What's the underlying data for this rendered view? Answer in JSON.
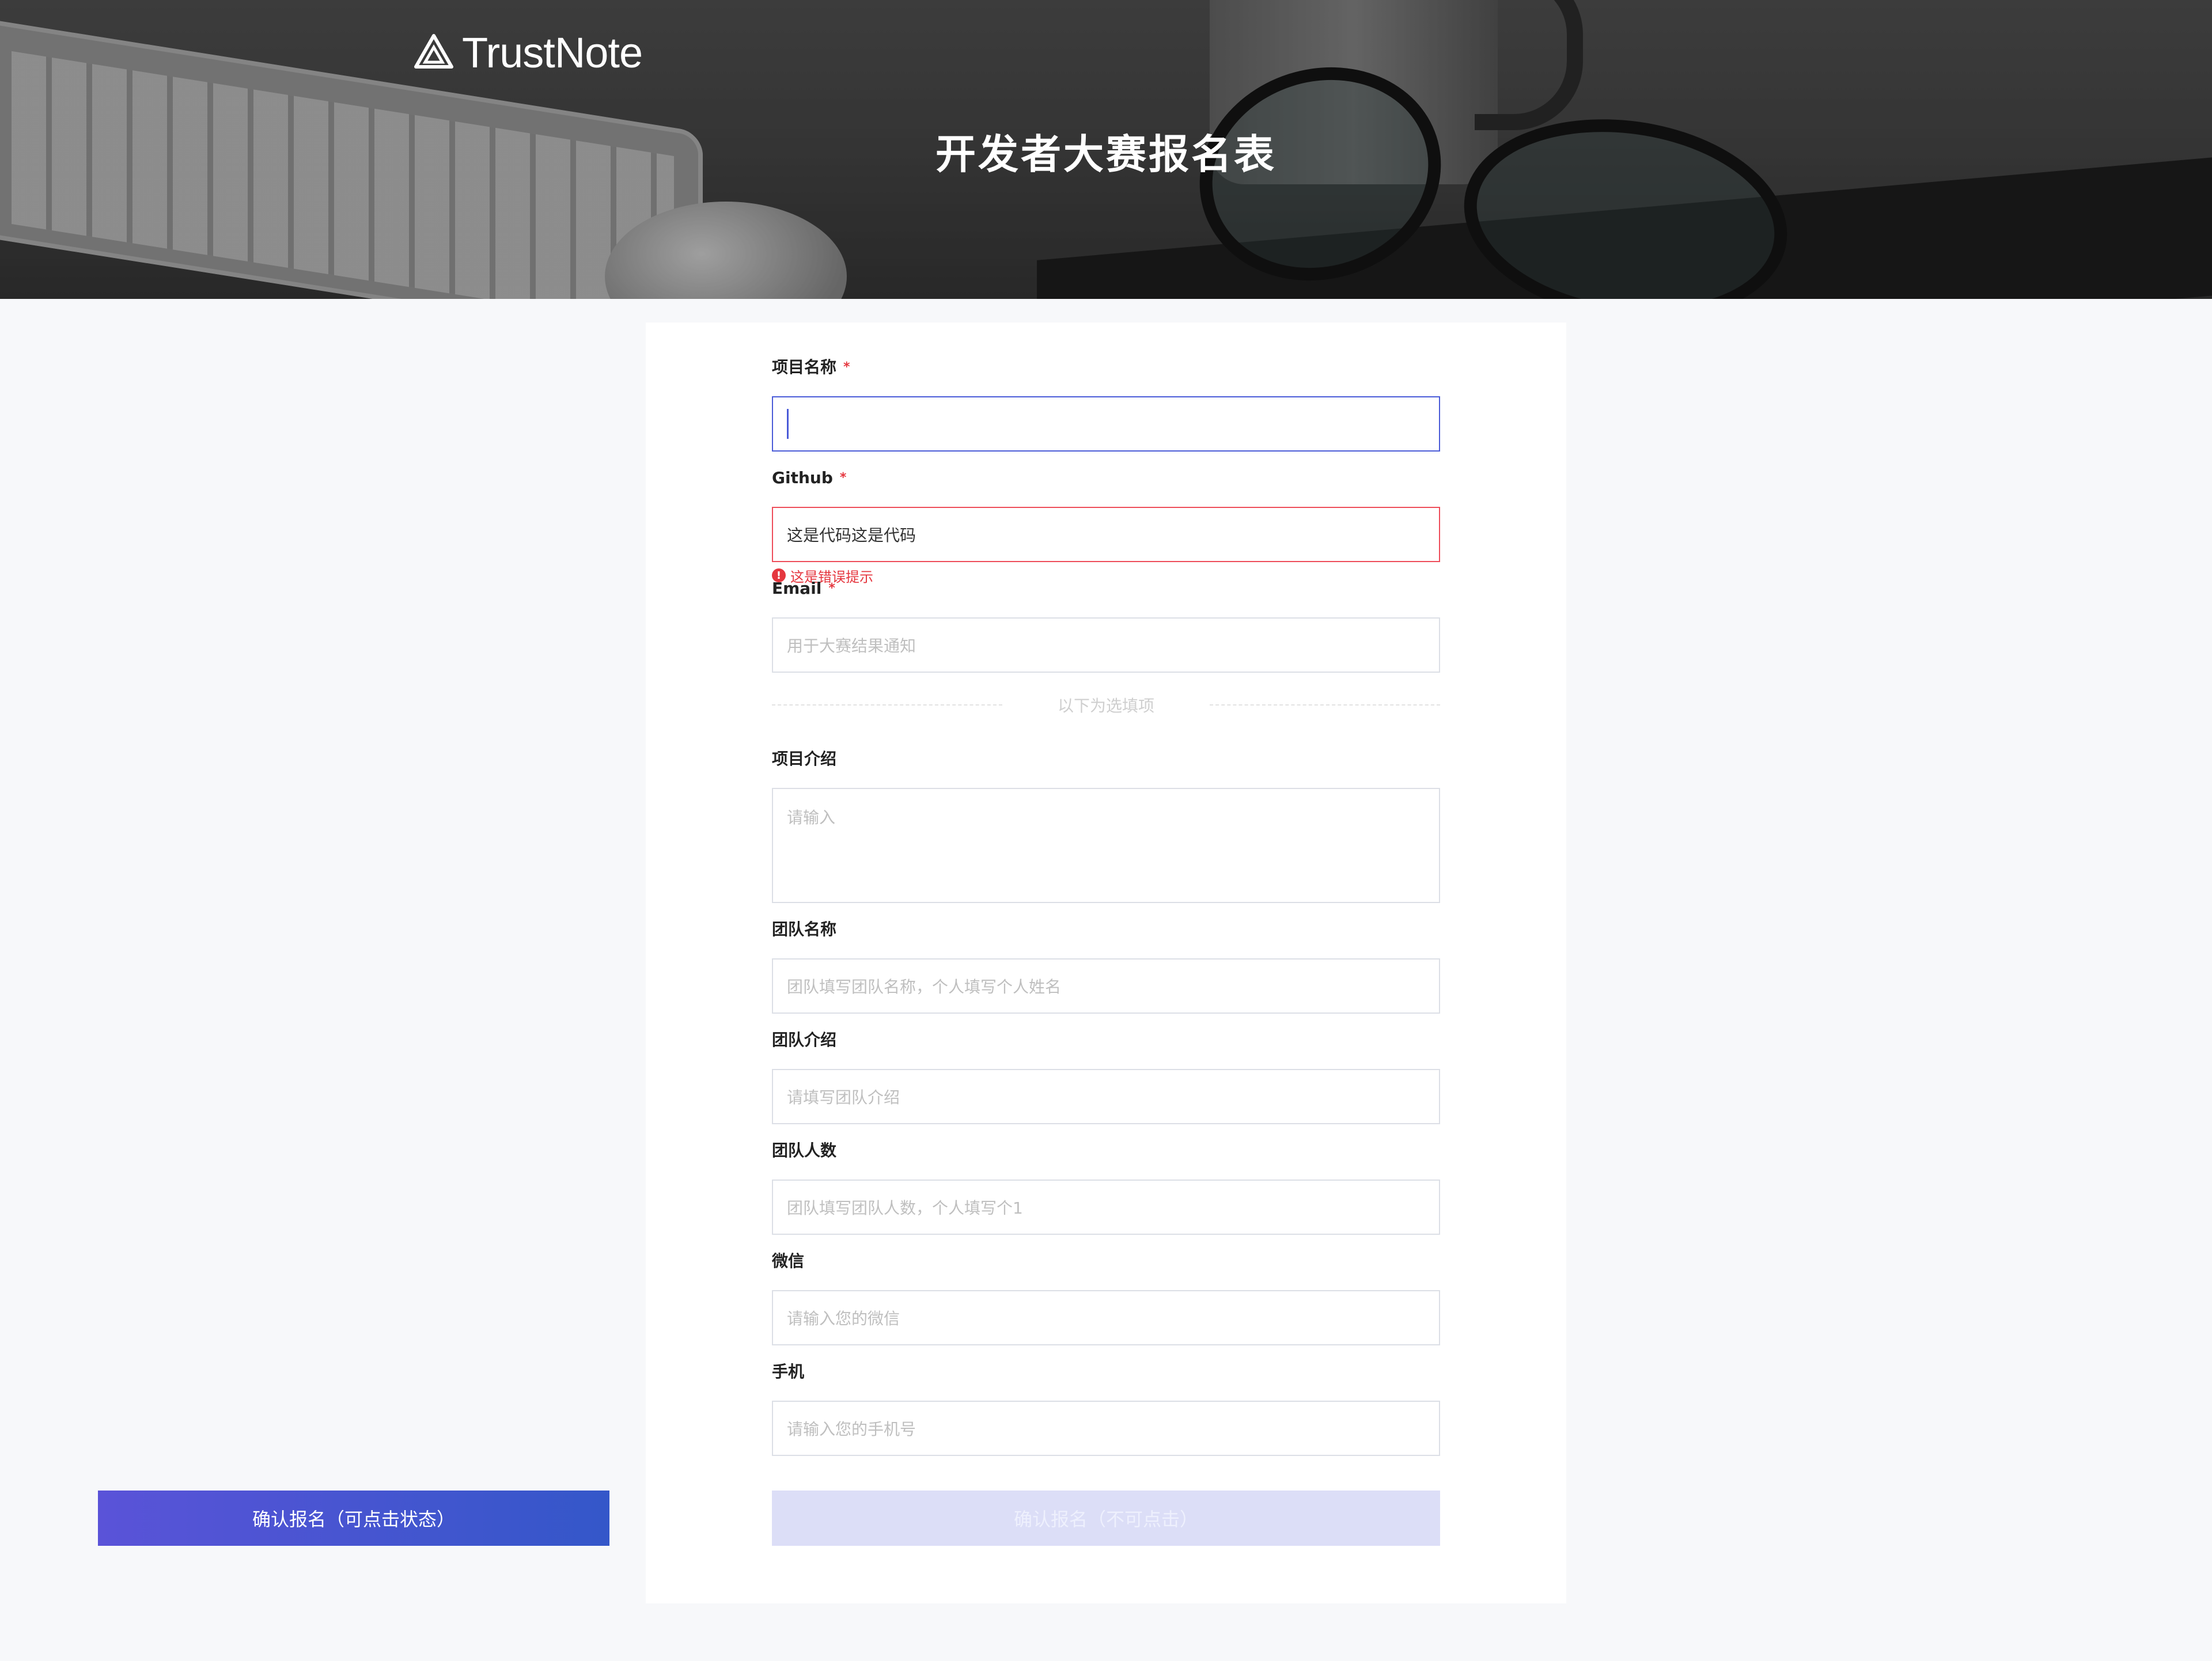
{
  "brand": {
    "name": "TrustNote"
  },
  "page": {
    "title": "开发者大赛报名表"
  },
  "form": {
    "project_name": {
      "label": "项目名称",
      "required_mark": "*",
      "value": ""
    },
    "github": {
      "label": "Github",
      "required_mark": "*",
      "value": "这是代码这是代码",
      "error": "这是错误提示",
      "error_icon": "!"
    },
    "email": {
      "label": "Email",
      "required_mark": "*",
      "placeholder": "用于大赛结果通知"
    },
    "optional_divider": "以下为选填项",
    "project_intro": {
      "label": "项目介绍",
      "placeholder": "请输入"
    },
    "team_name": {
      "label": "团队名称",
      "placeholder": "团队填写团队名称，个人填写个人姓名"
    },
    "team_intro": {
      "label": "团队介绍",
      "placeholder": "请填写团队介绍"
    },
    "team_size": {
      "label": "团队人数",
      "placeholder": "团队填写团队人数，个人填写个1"
    },
    "wechat": {
      "label": "微信",
      "placeholder": "请输入您的微信"
    },
    "phone": {
      "label": "手机",
      "placeholder": "请输入您的手机号"
    }
  },
  "buttons": {
    "submit_enabled": "确认报名（可点击状态）",
    "submit_disabled": "确认报名（不可点击）"
  },
  "colors": {
    "accent": "#4a5bd8",
    "error": "#e5373f",
    "button_gradient_start": "#5a53d8",
    "button_gradient_end": "#3457c9",
    "button_disabled": "#dcdef7"
  }
}
